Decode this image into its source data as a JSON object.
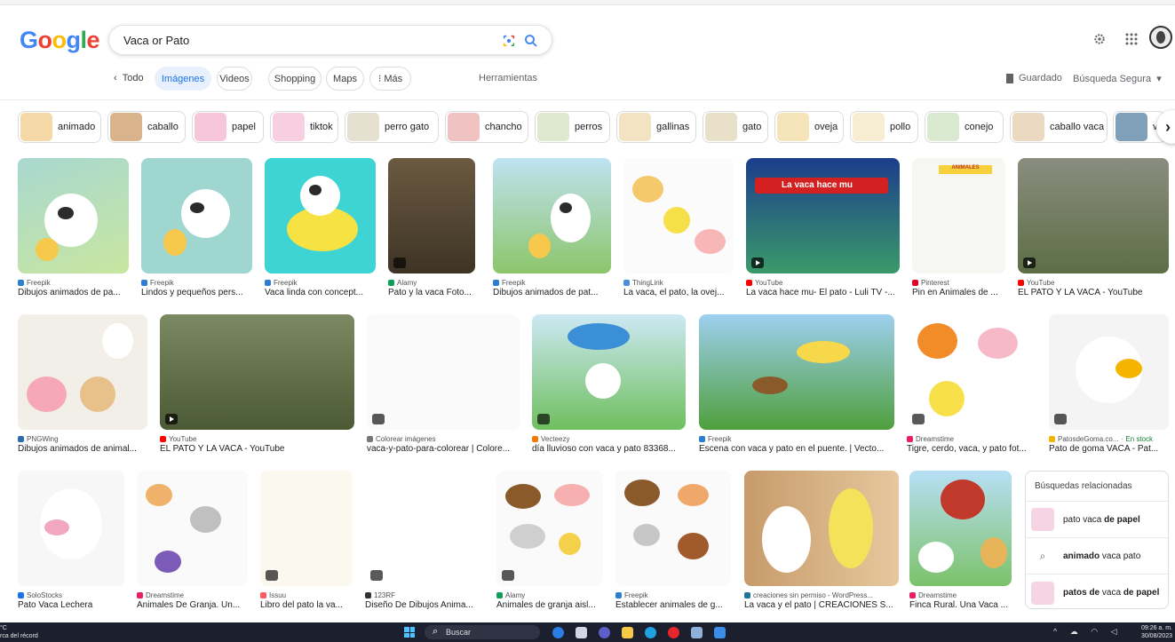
{
  "brand": {
    "logo_letters": [
      "G",
      "o",
      "o",
      "g",
      "l",
      "e"
    ],
    "logo_colors": [
      "#4285F4",
      "#EA4335",
      "#FBBC05",
      "#4285F4",
      "#34A853",
      "#EA4335"
    ]
  },
  "search": {
    "query": "Vaca or Pato"
  },
  "header_icons": {
    "settings": "gear-icon",
    "apps": "apps-grid-icon",
    "account": "avatar"
  },
  "nav": {
    "back_label": "Todo",
    "tabs": [
      {
        "label": "Imágenes",
        "active": true
      },
      {
        "label": "Videos"
      },
      {
        "label": "Shopping"
      },
      {
        "label": "Maps"
      },
      {
        "label": "Más"
      }
    ],
    "tools_label": "Herramientas",
    "saved_label": "Guardado",
    "safe_search_label": "Búsqueda Segura"
  },
  "filter_chips": [
    "animado",
    "caballo",
    "papel",
    "tiktok",
    "perro gato",
    "chancho",
    "perros",
    "gallinas",
    "gato",
    "oveja",
    "pollo",
    "conejo",
    "caballo vaca",
    "v"
  ],
  "results": [
    {
      "source": "Freepik",
      "title": "Dibujos animados de pa...",
      "color": "#2d7dd2"
    },
    {
      "source": "Freepik",
      "title": "Lindos y pequeños pers...",
      "color": "#2d7dd2"
    },
    {
      "source": "Freepik",
      "title": "Vaca linda con concept...",
      "color": "#2d7dd2"
    },
    {
      "source": "Alamy",
      "title": "Pato y la vaca Foto...",
      "color": "#0f9d58"
    },
    {
      "source": "Freepik",
      "title": "Dibujos animados de pat...",
      "color": "#2d7dd2"
    },
    {
      "source": "ThingLink",
      "title": "La vaca, el pato, la ovej...",
      "color": "#4a8fd9"
    },
    {
      "source": "YouTube",
      "title": "La vaca hace mu- El pato - Luli TV -...",
      "color": "#ff0000"
    },
    {
      "source": "Pinterest",
      "title": "Pin en Animales de ...",
      "color": "#e60023"
    },
    {
      "source": "YouTube",
      "title": "EL PATO Y LA VACA - YouTube",
      "color": "#ff0000"
    },
    {
      "source": "PNGWing",
      "title": "Dibujos animados de animal...",
      "color": "#2b6cb0"
    },
    {
      "source": "YouTube",
      "title": "EL PATO Y LA VACA - YouTube",
      "color": "#ff0000"
    },
    {
      "source": "Colorear imágenes",
      "title": "vaca-y-pato-para-colorear | Colore...",
      "color": "#777777"
    },
    {
      "source": "Vecteezy",
      "title": "día lluvioso con vaca y pato 83368...",
      "color": "#f57c00"
    },
    {
      "source": "Freepik",
      "title": "Escena con vaca y pato en el puente. | Vecto...",
      "color": "#2d7dd2"
    },
    {
      "source": "Dreamstime",
      "title": "Tigre, cerdo, vaca, y pato fot...",
      "color": "#e91e63"
    },
    {
      "source": "PatosdeGoma.co...",
      "stock": "· En stock",
      "title": "Pato de goma VACA - Pat...",
      "color": "#f4b400"
    },
    {
      "source": "SoloStocks",
      "title": "Pato Vaca Lechera",
      "color": "#1a73e8"
    },
    {
      "source": "Dreamstime",
      "title": "Animales De Granja. Un...",
      "color": "#e91e63"
    },
    {
      "source": "Issuu",
      "title": "Libro del pato la va...",
      "color": "#ff5a5f"
    },
    {
      "source": "123RF",
      "title": "Diseño De Dibujos Anima...",
      "color": "#333333"
    },
    {
      "source": "Alamy",
      "title": "Animales de granja aisl...",
      "color": "#0f9d58"
    },
    {
      "source": "Freepik",
      "title": "Establecer animales de g...",
      "color": "#2d7dd2"
    },
    {
      "source": "creaciones sin permiso - WordPress...",
      "title": "La vaca y el pato | CREACIONES S...",
      "color": "#21759b"
    },
    {
      "source": "Dreamstime",
      "title": "Finca Rural. Una Vaca ...",
      "color": "#e91e63"
    }
  ],
  "video_banner_text": "La vaca hace mu",
  "chart_label_animales": "ANIMALES",
  "related": {
    "heading": "Búsquedas relacionadas",
    "items": [
      {
        "pre": "pato vaca ",
        "bold": "de papel",
        "post": ""
      },
      {
        "pre": "",
        "bold": "animado",
        "post": " vaca pato"
      },
      {
        "pre": "",
        "bold": "patos de",
        "post": " vaca ",
        "bold2": "de papel"
      }
    ]
  },
  "taskbar": {
    "weather_temp": "°C",
    "weather_text": "rca del récord",
    "search_label": "Buscar",
    "time": "09:26 a. m.",
    "date": "30/08/2023"
  }
}
